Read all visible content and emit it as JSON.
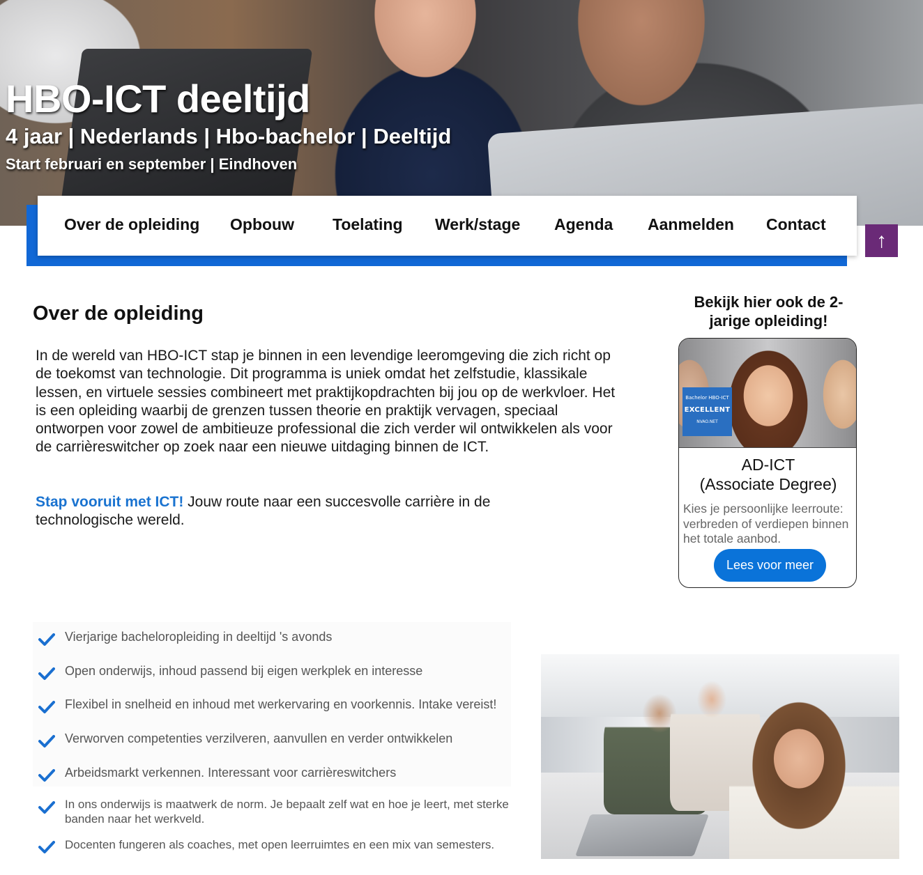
{
  "hero": {
    "title": "HBO-ICT deeltijd",
    "subtitle": "4 jaar | Nederlands | Hbo-bachelor | Deeltijd",
    "start": "Start februari en september | Eindhoven"
  },
  "nav": {
    "items": [
      {
        "label": "Over de opleiding"
      },
      {
        "label": "Opbouw"
      },
      {
        "label": "Toelating"
      },
      {
        "label": "Werk/stage"
      },
      {
        "label": "Agenda"
      },
      {
        "label": "Aanmelden"
      },
      {
        "label": "Contact"
      }
    ],
    "back_to_top_symbol": "↑"
  },
  "main": {
    "section_title": "Over de opleiding",
    "intro": "In de wereld van HBO-ICT stap je binnen in een levendige leeromgeving die zich richt op de toekomst van technologie. Dit programma is uniek omdat het zelfstudie, klassikale lessen, en virtuele sessies combineert met praktijkopdrachten bij jou op de werkvloer. Het is een opleiding waarbij de grenzen tussen theorie en praktijk vervagen, speciaal ontworpen voor zowel de ambitieuze professional die zich verder wil ontwikkelen als voor de carrièreswitcher op zoek naar een nieuwe uitdaging binnen de ICT.",
    "cta_link": "Stap vooruit met ICT!",
    "cta_text": " Jouw route naar een succesvolle carrière in de technologische wereld."
  },
  "sidebar": {
    "heading": "Bekijk hier ook de 2-jarige opleiding!",
    "badge": {
      "line1": "Bachelor HBO-ICT",
      "line2": "EXCELLENT",
      "line3": "NVAO.NET"
    },
    "card_title_1": "AD-ICT",
    "card_title_2": "(Associate Degree)",
    "card_text": "Kies je persoonlijke leerroute: verbreden of verdiepen binnen het totale aanbod.",
    "button_label": "Lees voor meer"
  },
  "checklist": {
    "items": [
      "Vierjarige bacheloropleiding in deeltijd 's avonds",
      "Open onderwijs, inhoud passend bij eigen werkplek en interesse",
      "Flexibel in snelheid en inhoud met werkervaring en voorkennis. Intake vereist!",
      "Verworven competenties verzilveren, aanvullen en verder ontwikkelen",
      "Arbeidsmarkt verkennen. Interessant voor carrièreswitchers",
      "In ons onderwijs is maatwerk de norm. Je bepaalt zelf wat en hoe je leert, met sterke banden naar het werkveld.",
      "Docenten fungeren als coaches, met open leerruimtes en een mix van semesters."
    ]
  },
  "colors": {
    "accent_blue": "#1168d6",
    "button_blue": "#0a73d9",
    "link_blue": "#1a73d0",
    "back_to_top_purple": "#6a2a77",
    "check_blue": "#1a6fd0"
  },
  "icons": {
    "checkmark": "check-icon",
    "back_to_top": "arrow-up-icon"
  }
}
